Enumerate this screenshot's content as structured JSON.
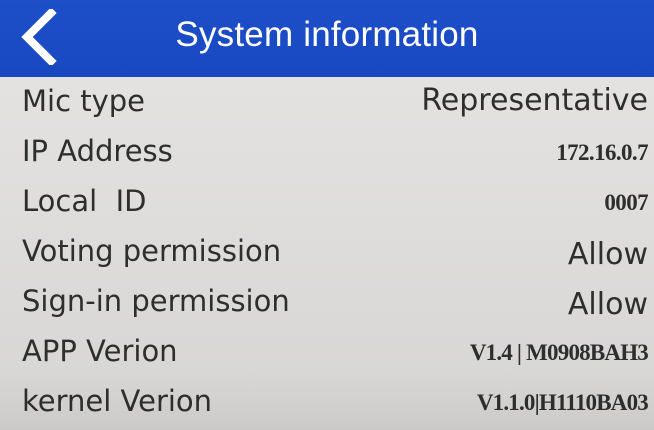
{
  "header": {
    "title": "System information",
    "back_icon": "chevron-left-icon",
    "background_color": "#1b4cc6",
    "text_color": "#ffffff"
  },
  "rows": [
    {
      "label": "Mic type",
      "value": "Representative"
    },
    {
      "label": "IP Address",
      "value": "172.16.0.7"
    },
    {
      "label": "Local  ID",
      "value": "0007"
    },
    {
      "label": "Voting permission",
      "value": "Allow"
    },
    {
      "label": "Sign-in permission",
      "value": "Allow"
    },
    {
      "label": "APP Verion",
      "value": "V1.4 | M0908BAH3"
    },
    {
      "label": "kernel Verion",
      "value": "V1.1.0|H1110BA03"
    }
  ],
  "colors": {
    "background": "#dfdedd",
    "text": "#2e2e2e"
  }
}
